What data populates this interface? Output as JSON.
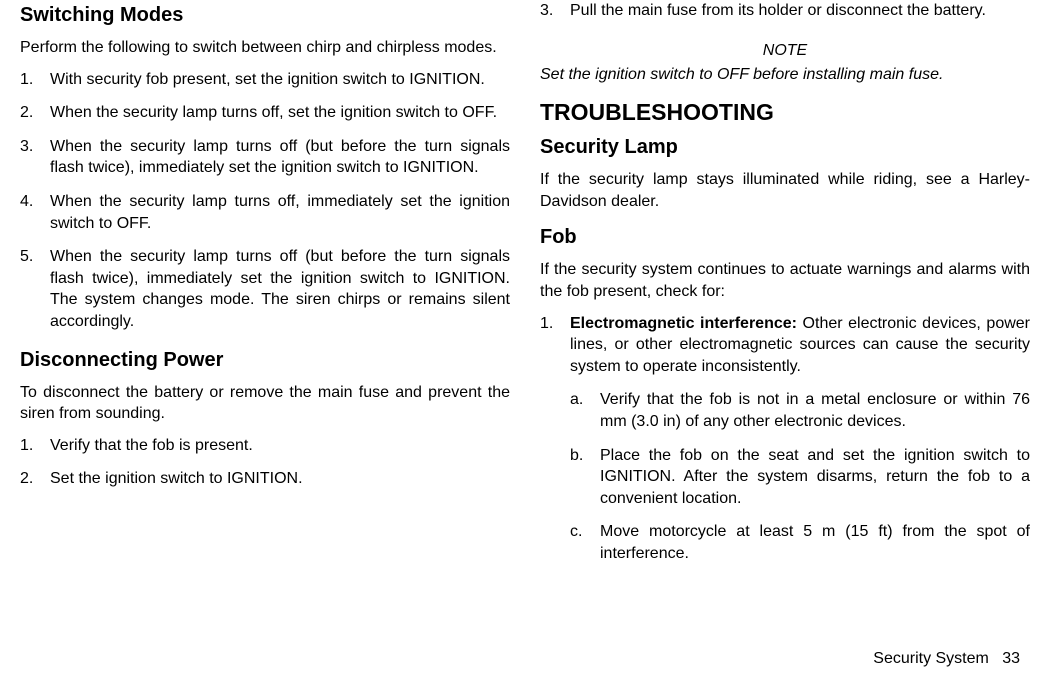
{
  "left": {
    "heading1": "Switching Modes",
    "para1": "Perform the following to switch between chirp and chirpless modes.",
    "items": [
      "With security fob present, set the ignition switch to IGNITION.",
      "When the security lamp turns off, set the ignition switch to OFF.",
      "When the security lamp turns off (but before the turn signals flash twice), immediately set the ignition switch to IGNITION.",
      "When the security lamp turns off, immediately set the ignition switch to OFF.",
      "When the security lamp turns off (but before the turn signals flash twice), immediately set the ignition switch to IGNITION. The system changes mode. The siren chirps or remains silent accordingly."
    ],
    "heading2": "Disconnecting Power",
    "para2": "To disconnect the battery or remove the main fuse and prevent the siren from sounding.",
    "items2": [
      "Verify that the fob is present.",
      "Set the ignition switch to IGNITION."
    ]
  },
  "right": {
    "item3": "Pull the main fuse from its holder or disconnect the battery.",
    "noteLabel": "NOTE",
    "noteText": "Set the ignition switch to OFF before installing main fuse.",
    "h1": "TROUBLESHOOTING",
    "sec1Heading": "Security Lamp",
    "sec1Para": "If the security lamp stays illuminated while riding, see a Harley-Davidson dealer.",
    "sec2Heading": "Fob",
    "sec2Para": "If the security system continues to actuate warnings and alarms with the fob present, check for:",
    "fobItem1Bold": "Electromagnetic interference:",
    "fobItem1Rest": " Other electronic devices, power lines, or other electromagnetic sources can cause the security system to operate inconsistently.",
    "fobSub": [
      "Verify that the fob is not in a metal enclosure or within 76 mm (3.0 in) of any other electronic devices.",
      "Place the fob on the seat and set the ignition switch to IGNITION. After the system disarms, return the fob to a convenient location.",
      "Move motorcycle at least 5 m (15 ft) from the spot of interference."
    ]
  },
  "footer": {
    "section": "Security System",
    "page": "33"
  },
  "nums": {
    "n1": "1.",
    "n2": "2.",
    "n3": "3.",
    "n4": "4.",
    "n5": "5.",
    "a": "a.",
    "b": "b.",
    "c": "c."
  }
}
